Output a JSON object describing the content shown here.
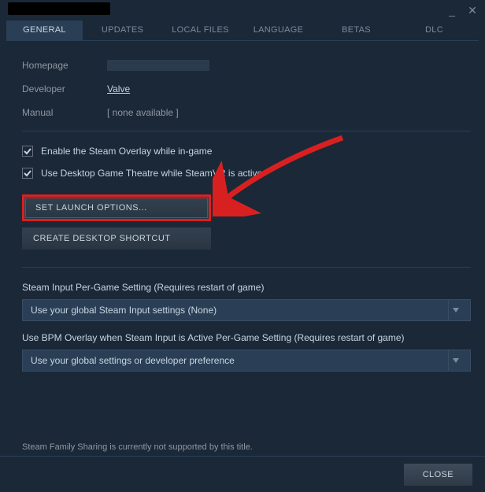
{
  "tabs": {
    "general": "GENERAL",
    "updates": "UPDATES",
    "localfiles": "LOCAL FILES",
    "language": "LANGUAGE",
    "betas": "BETAS",
    "dlc": "DLC"
  },
  "labels": {
    "homepage": "Homepage",
    "developer": "Developer",
    "manual": "Manual"
  },
  "values": {
    "developer": "Valve",
    "manual": "[ none available ]"
  },
  "checkboxes": {
    "overlay": "Enable the Steam Overlay while in-game",
    "theatre": "Use Desktop Game Theatre while SteamVR is active"
  },
  "buttons": {
    "launch": "SET LAUNCH OPTIONS...",
    "shortcut": "CREATE DESKTOP SHORTCUT",
    "close": "CLOSE"
  },
  "sections": {
    "steaminput_label": "Steam Input Per-Game Setting (Requires restart of game)",
    "steaminput_value": "Use your global Steam Input settings (None)",
    "bpm_label": "Use BPM Overlay when Steam Input is Active Per-Game Setting (Requires restart of game)",
    "bpm_value": "Use your global settings or developer preference"
  },
  "footer": {
    "sharing": "Steam Family Sharing is currently not supported by this title."
  }
}
